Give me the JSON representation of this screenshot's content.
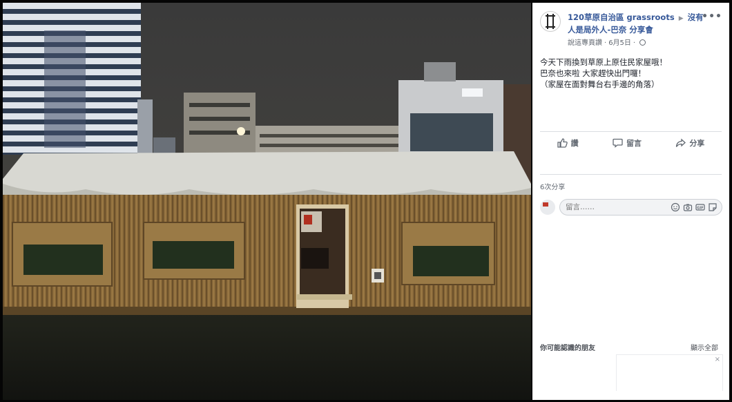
{
  "post": {
    "page_name": "120草原自治區 grassroots",
    "target_name": "沒有人是局外人-巴奈 分享會",
    "edited_by": "說這專頁讚",
    "date": "6月5日",
    "body_lines": [
      "今天下雨換到草原上原住民家屋哦！",
      "巴奈也來啦 大家趕快出門囉！",
      "（家屋在面對舞台右手邊的角落）"
    ]
  },
  "actions": {
    "like_label": "讚",
    "comment_label": "留言",
    "share_label": "分享"
  },
  "shares_count": "6次分享",
  "comment_input": {
    "placeholder": "留言……"
  },
  "sidebar": {
    "friends_heading": "你可能認識的朋友",
    "show_all": "顯示全部",
    "close": "×"
  },
  "colors": {
    "link_blue": "#365899",
    "text_gray": "#606770",
    "divider": "#dadde1"
  }
}
